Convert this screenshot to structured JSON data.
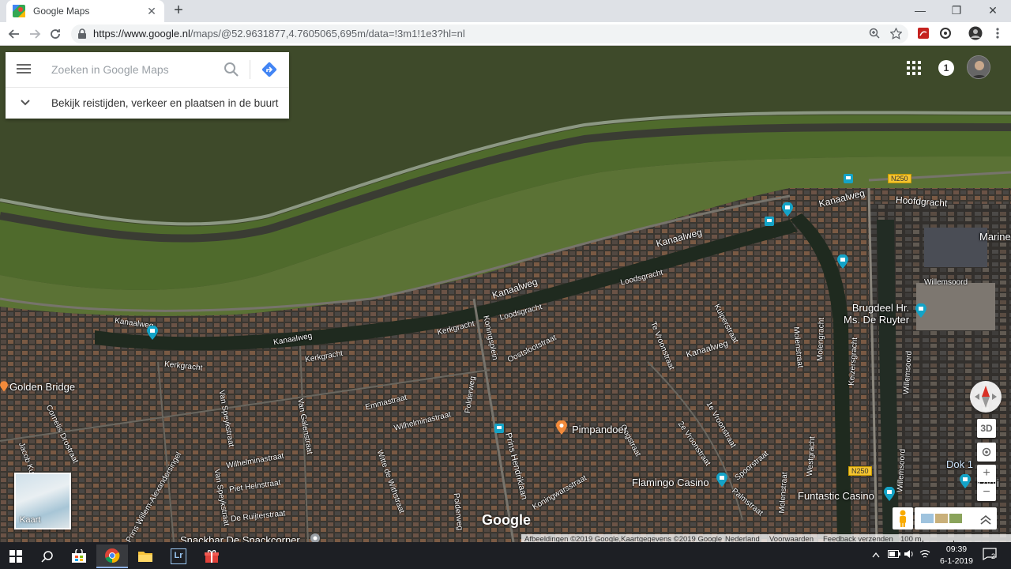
{
  "browser": {
    "tab_title": "Google Maps",
    "tab_close": "✕",
    "new_tab": "+",
    "url_host": "https://www.google.nl",
    "url_path": "/maps/@52.9631877,4.7605065,695m/data=!3m1!1e3?hl=nl",
    "window_minimize": "—",
    "window_maximize": "❐",
    "window_close": "✕"
  },
  "maps": {
    "search_placeholder": "Zoeken in Google Maps",
    "explore_label": "Bekijk reistijden, verkeer en plaatsen in de buurt",
    "notifications_count": "1",
    "minimap_label": "Kaart",
    "google_logo": "Google",
    "btn_3d": "3D",
    "btn_zoom_in": "+",
    "btn_zoom_out": "−",
    "footer": {
      "imagery": "Afbeeldingen ©2019 Google,Kaartgegevens ©2019 Google",
      "country": "Nederland",
      "terms": "Voorwaarden",
      "feedback": "Feedback verzenden",
      "scale": "100 m"
    },
    "streets": {
      "kanaalweg1": "Kanaalweg",
      "kanaalweg2": "Kanaalweg",
      "kanaalweg3": "Kanaalweg",
      "kanaalweg4": "Kanaalweg",
      "kanaalweg5": "Kanaalweg",
      "hoofdgracht": "Hoofdgracht",
      "loodsgracht1": "Loodsgracht",
      "loodsgracht2": "Loodsgracht",
      "kerkgracht1": "Kerkgracht",
      "kerkgracht2": "Kerkgracht",
      "kerkgracht3": "Kerkgracht",
      "koningsplein": "Koningsplein",
      "oostslootstraat": "Oostslootstraat",
      "tevroonstraat": "Te Vroonstraat",
      "kuiperstraat": "Kuiperstraat",
      "molenstraat1": "Molenstraat",
      "molengracht": "Molengracht",
      "keizersgracht": "Keizersgracht",
      "willemsoord1": "Willemsoord",
      "willemsoord2": "Willemsoord",
      "willemsoord3": "Willemsoord",
      "emmastraat": "Emmastraat",
      "wilhelminastraat1": "Wilhelminastraat",
      "wilhelminastraat2": "Wilhelminastraat",
      "vangalenstraat": "Van Galenstraat",
      "vanspeykstraat1": "Van Speykstraat",
      "vanspeykstraat2": "Van Speykstraat",
      "corneliedrostraat": "Cornelis Drostraat",
      "willemalexanderweg": "Prins Willem-Alexandersingel",
      "pietheinstraat": "Piet Heinstraat",
      "deruijterstraat": "De Ruijterstraat",
      "wittedewithstraat": "Witte de Withstraat",
      "polderweg1": "Polderweg",
      "polderweg2": "Polderweg",
      "prinshendriklaan": "Prins Hendriklaan",
      "koningwarsstraat": "Koningwarsstraat",
      "oogstraat": "Oogstraat",
      "tevroonstraat1e": "1e Vroonstraat",
      "tevroonstraat2e": "2e Vroonstraat",
      "spoorstraat": "Spoorstraat",
      "palmstraat": "Palmstraat",
      "molenstraat2": "Molenstraat",
      "westgracht": "Westgracht",
      "jacobstraat": "Jacob Kuyt",
      "n250_1": "N250",
      "n250_2": "N250"
    },
    "pois": {
      "golden_bridge": "Golden Bridge",
      "brugdeel": "Brugdeel Hr.\nMs. De Ruyter",
      "pimpandoer": "Pimpandoer",
      "flamingo": "Flamingo Casino",
      "funtastic": "Funtastic Casino",
      "snackbar": "Snackbar De Snackcorner",
      "marine": "Marine",
      "dok": "Dok 1",
      "koolhaven": "Kooli"
    }
  },
  "taskbar": {
    "time": "09:39",
    "date": "6-1-2019",
    "notifications": "2",
    "lightroom": "Lr"
  },
  "colors": {
    "sea": "#3f4a2a",
    "dike": "#4f6a2c",
    "accent": "#4285f4",
    "poi_teal": "#14a3c7",
    "poi_orange": "#f28a3a"
  }
}
